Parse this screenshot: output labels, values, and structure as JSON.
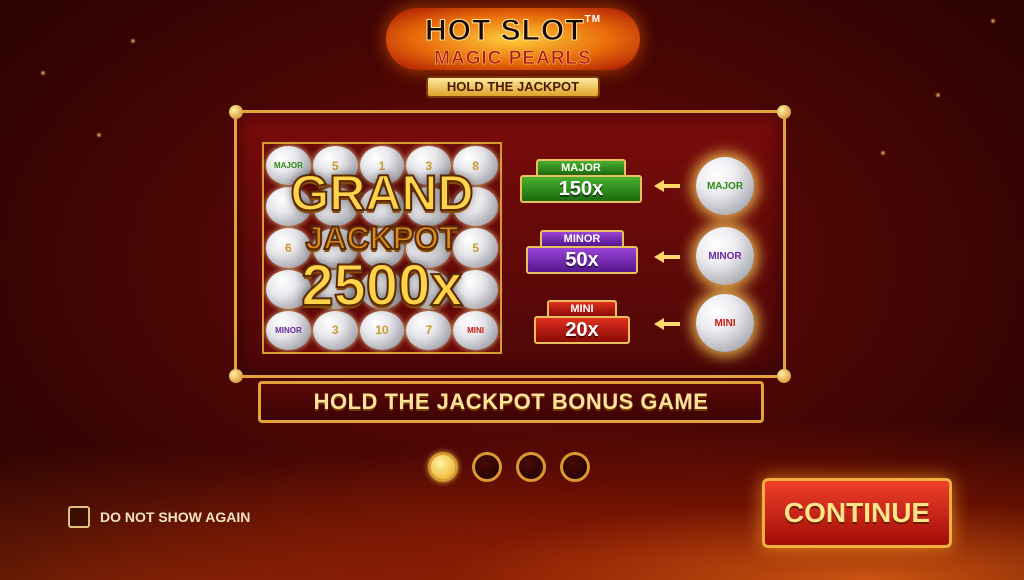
{
  "logo": {
    "title": "HOT SLOT",
    "trademark": "TM",
    "subtitle": "MAGIC PEARLS",
    "ribbon": "HOLD THE JACKPOT"
  },
  "grid": {
    "pearls": [
      {
        "label": "MAJOR",
        "kind": "major"
      },
      {
        "label": "5",
        "kind": "num"
      },
      {
        "label": "1",
        "kind": "num"
      },
      {
        "label": "3",
        "kind": "num"
      },
      {
        "label": "8",
        "kind": "num"
      },
      {
        "label": "",
        "kind": "num"
      },
      {
        "label": "",
        "kind": "num"
      },
      {
        "label": "",
        "kind": "num"
      },
      {
        "label": "",
        "kind": "num"
      },
      {
        "label": "",
        "kind": "num"
      },
      {
        "label": "6",
        "kind": "num"
      },
      {
        "label": "",
        "kind": "num"
      },
      {
        "label": "",
        "kind": "num"
      },
      {
        "label": "",
        "kind": "num"
      },
      {
        "label": "5",
        "kind": "num"
      },
      {
        "label": "",
        "kind": "num"
      },
      {
        "label": "",
        "kind": "num"
      },
      {
        "label": "",
        "kind": "num"
      },
      {
        "label": "",
        "kind": "num"
      },
      {
        "label": "",
        "kind": "num"
      },
      {
        "label": "MINOR",
        "kind": "minor"
      },
      {
        "label": "3",
        "kind": "num"
      },
      {
        "label": "10",
        "kind": "num"
      },
      {
        "label": "7",
        "kind": "num"
      },
      {
        "label": "MINI",
        "kind": "mini"
      }
    ],
    "grand_line1": "GRAND",
    "grand_line2": "JACKPOT",
    "grand_value": "2500x"
  },
  "jackpots": [
    {
      "name": "MAJOR",
      "value": "150x",
      "pearl_label": "MAJOR",
      "color": "#2e8a14"
    },
    {
      "name": "MINOR",
      "value": "50x",
      "pearl_label": "MINOR",
      "color": "#6a2aa0"
    },
    {
      "name": "MINI",
      "value": "20x",
      "pearl_label": "MINI",
      "color": "#c41a10"
    }
  ],
  "banner": "HOLD THE JACKPOT BONUS GAME",
  "pagination": {
    "total": 4,
    "current": 1
  },
  "checkbox": {
    "label": "DO NOT SHOW AGAIN",
    "checked": false
  },
  "continue_label": "CONTINUE",
  "colors": {
    "accent_gold": "#e4a23a",
    "background_red": "#4a0604",
    "button_red": "#d0281a"
  }
}
